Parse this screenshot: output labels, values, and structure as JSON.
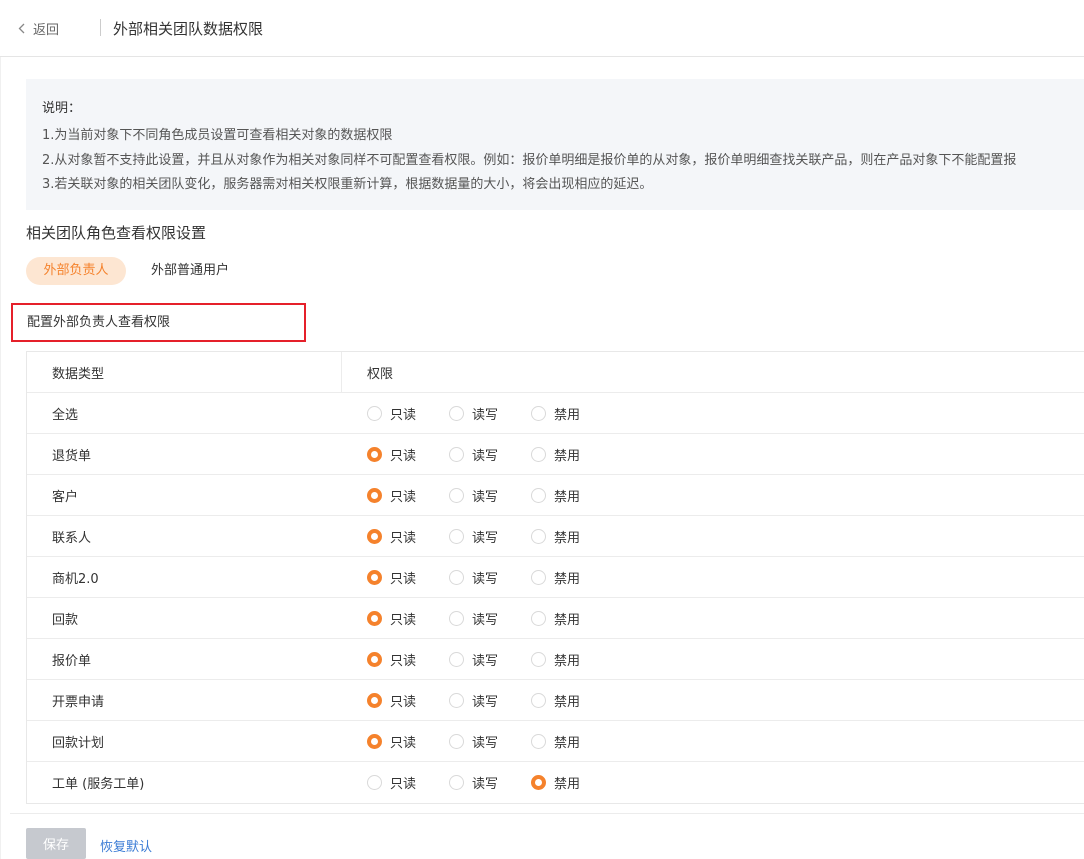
{
  "header": {
    "back_label": "返回",
    "title": "外部相关团队数据权限"
  },
  "notice": {
    "title": "说明：",
    "lines": [
      "1.为当前对象下不同角色成员设置可查看相关对象的数据权限",
      "2.从对象暂不支持此设置，并且从对象作为相关对象同样不可配置查看权限。例如：报价单明细是报价单的从对象，报价单明细查找关联产品，则在产品对象下不能配置报",
      "3.若关联对象的相关团队变化，服务器需对相关权限重新计算，根据数据量的大小，将会出现相应的延迟。"
    ]
  },
  "section_title": "相关团队角色查看权限设置",
  "role_tabs": [
    {
      "label": "外部负责人",
      "active": true
    },
    {
      "label": "外部普通用户",
      "active": false
    }
  ],
  "config_label": "配置外部负责人查看权限",
  "table": {
    "headers": {
      "type": "数据类型",
      "perm": "权限"
    },
    "options": [
      "只读",
      "读写",
      "禁用"
    ],
    "rows": [
      {
        "name": "全选",
        "selected": null
      },
      {
        "name": "退货单",
        "selected": "只读"
      },
      {
        "name": "客户",
        "selected": "只读"
      },
      {
        "name": "联系人",
        "selected": "只读"
      },
      {
        "name": "商机2.0",
        "selected": "只读"
      },
      {
        "name": "回款",
        "selected": "只读"
      },
      {
        "name": "报价单",
        "selected": "只读"
      },
      {
        "name": "开票申请",
        "selected": "只读"
      },
      {
        "name": "回款计划",
        "selected": "只读"
      },
      {
        "name": "工单 (服务工单)",
        "selected": "禁用"
      }
    ]
  },
  "footer": {
    "save_label": "保存",
    "reset_label": "恢复默认"
  },
  "colors": {
    "accent": "#f5822c",
    "accent_bg": "#fde6d2",
    "highlight_border": "#e5202a",
    "link": "#3a7bd5"
  }
}
